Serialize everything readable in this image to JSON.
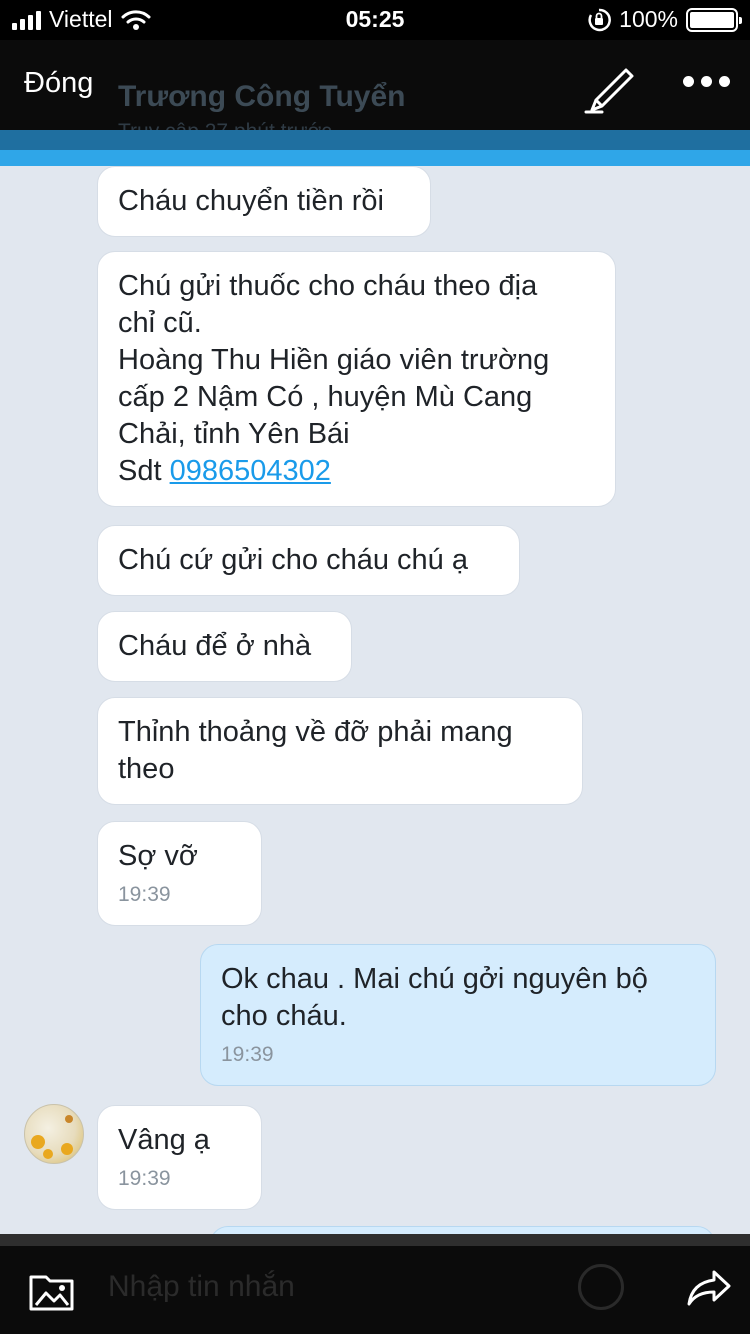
{
  "status_bar": {
    "carrier": "Viettel",
    "time": "05:25",
    "battery": "100%"
  },
  "header": {
    "close_label": "Đóng",
    "contact_name": "Trương Công Tuyển",
    "last_seen": "Truy cập 27 phút trước"
  },
  "messages": [
    {
      "text": "Cháu chuyển tiền rồi"
    },
    {
      "lines": [
        "Chú gửi thuốc cho cháu theo địa",
        "chỉ cũ.",
        "Hoàng Thu Hiền giáo viên trường",
        "cấp 2 Nậm Có , huyện Mù Cang",
        "Chải, tỉnh Yên Bái"
      ],
      "phone_prefix": "Sdt ",
      "phone": "0986504302"
    },
    {
      "text": "Chú cứ gửi cho cháu chú ạ"
    },
    {
      "text": "Cháu để ở nhà"
    },
    {
      "lines": [
        "Thỉnh thoảng về đỡ phải mang",
        "theo"
      ]
    },
    {
      "text": "Sợ vỡ",
      "time": "19:39"
    },
    {
      "lines": [
        "Ok chau . Mai chú gởi nguyên bộ",
        "cho cháu."
      ],
      "time": "19:39"
    },
    {
      "text": "Vâng ạ",
      "time": "19:39"
    }
  ],
  "composer": {
    "placeholder": "Nhập tin nhắn"
  },
  "icons": {
    "edit": "pen-icon",
    "more": "more-dots-icon",
    "media": "photo-folder-icon",
    "emoji": "emoji-icon",
    "share": "share-forward-icon",
    "wifi": "wifi-icon",
    "lock": "rotation-lock-icon"
  },
  "colors": {
    "chat_bg": "#e1e7ef",
    "incoming": "#ffffff",
    "outgoing": "#d5ecfd",
    "link": "#1a9bea",
    "accent": "#2fa6e8"
  }
}
